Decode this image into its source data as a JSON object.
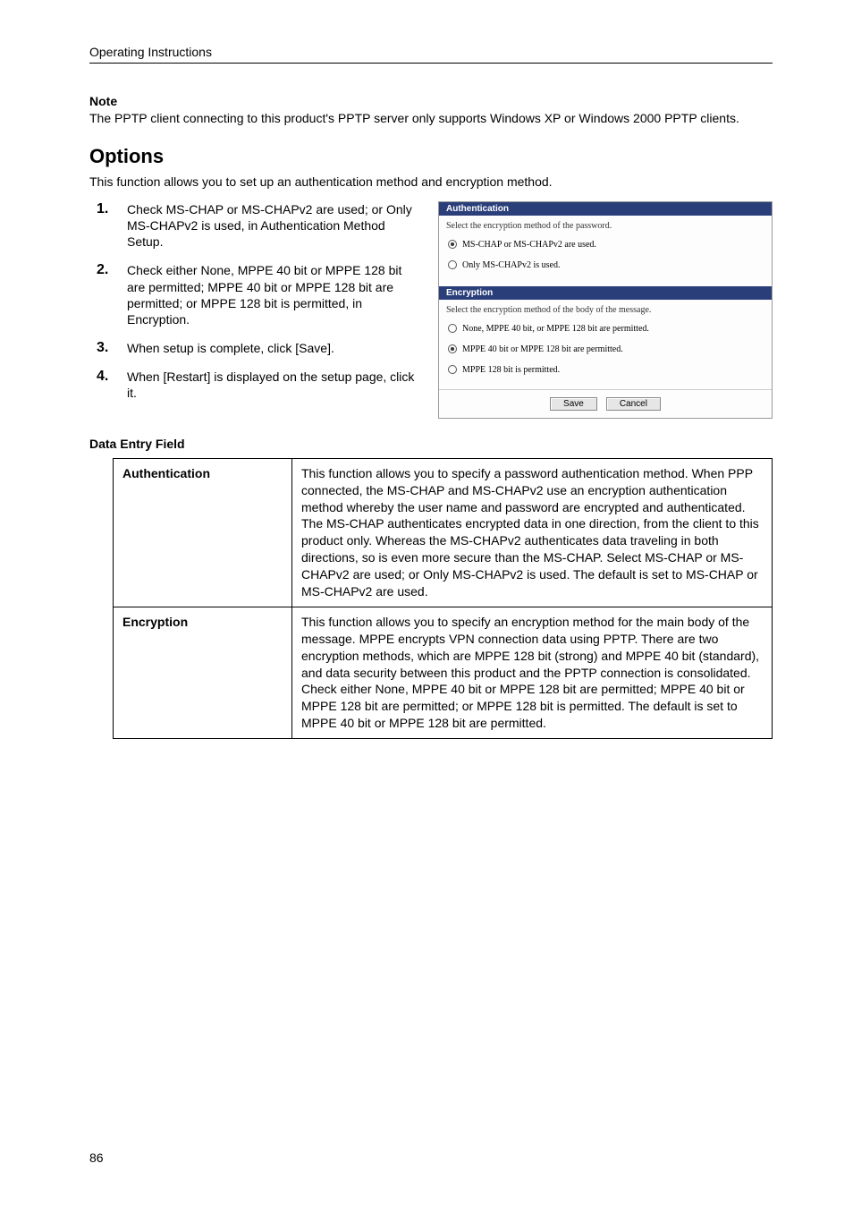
{
  "header": "Operating Instructions",
  "note": {
    "heading": "Note",
    "body": "The PPTP client connecting to this product's PPTP server only supports Windows XP or Windows 2000 PPTP clients."
  },
  "options": {
    "heading": "Options",
    "lead": "This function allows you to set up an authentication method and encryption method.",
    "steps": [
      "Check MS-CHAP or MS-CHAPv2 are used; or Only MS-CHAPv2 is used, in Authentication Method Setup.",
      "Check either None, MPPE 40 bit or MPPE 128 bit are permitted; MPPE 40 bit or MPPE 128 bit are permitted; or MPPE 128 bit is permitted, in Encryption.",
      "When setup is complete, click [Save].",
      "When [Restart] is displayed on the setup page, click it."
    ]
  },
  "panel": {
    "auth": {
      "title": "Authentication",
      "subtitle": "Select the encryption method of the password.",
      "radios": [
        {
          "label": "MS-CHAP or MS-CHAPv2 are used.",
          "checked": true
        },
        {
          "label": "Only MS-CHAPv2 is used.",
          "checked": false
        }
      ]
    },
    "enc": {
      "title": "Encryption",
      "subtitle": "Select the encryption method of the body of the message.",
      "radios": [
        {
          "label": "None, MPPE 40 bit, or MPPE 128 bit are permitted.",
          "checked": false
        },
        {
          "label": "MPPE 40 bit or MPPE 128 bit are permitted.",
          "checked": true
        },
        {
          "label": "MPPE 128 bit is permitted.",
          "checked": false
        }
      ]
    },
    "buttons": {
      "save": "Save",
      "cancel": "Cancel"
    }
  },
  "dataEntry": {
    "heading": "Data Entry Field",
    "rows": [
      {
        "term": "Authentication",
        "desc": "This function allows you to specify a password authentication method. When PPP connected, the MS-CHAP and MS-CHAPv2 use an encryption authentication method whereby the user name and password are encrypted and authenticated. The MS-CHAP authenticates encrypted data in one direction, from the client to this product only. Whereas the MS-CHAPv2 authenticates data traveling in both directions, so is even more secure than the MS-CHAP. Select MS-CHAP or MS-CHAPv2 are used; or Only MS-CHAPv2 is used. The default is set to MS-CHAP or MS-CHAPv2 are used."
      },
      {
        "term": "Encryption",
        "desc": "This function allows you to specify an encryption method for the main body of the message. MPPE encrypts VPN connection data using PPTP. There are two encryption methods, which are MPPE 128 bit (strong) and MPPE 40 bit (standard), and data security between this product and the PPTP connection is consolidated. Check either None, MPPE 40 bit or MPPE 128 bit are permitted; MPPE 40 bit or MPPE 128 bit are permitted; or MPPE 128 bit is permitted. The default is set to MPPE 40 bit or MPPE 128 bit are permitted."
      }
    ]
  },
  "pageNumber": "86"
}
